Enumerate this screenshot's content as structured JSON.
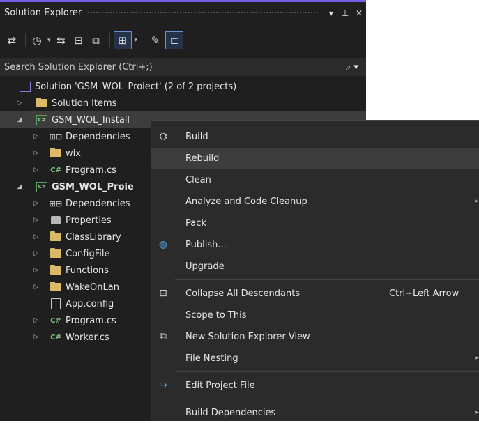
{
  "panel": {
    "title": "Solution Explorer",
    "buttons": {
      "dropdown": "▾",
      "pin": "ᚚ",
      "close": "✕"
    }
  },
  "toolbar": {
    "icons": [
      "sync-with-active-document-icon",
      "pending-changes-filter-icon",
      "switch-views-icon",
      "collapse-all-icon",
      "show-all-files-icon",
      "preview-selected-icon",
      "properties-icon",
      "filter-icon"
    ]
  },
  "search": {
    "placeholder": "Search Solution Explorer (Ctrl+;)",
    "icon": "search-icon"
  },
  "tree": {
    "solution": "Solution 'GSM_WOL_Proiect' (2 of 2 projects)",
    "items": [
      {
        "label": "Solution Items",
        "icon": "folder-icon"
      },
      {
        "label": "GSM_WOL_Install",
        "icon": "csproj-icon"
      },
      {
        "label": "Dependencies",
        "icon": "dependencies-icon"
      },
      {
        "label": "wix",
        "icon": "folder-icon"
      },
      {
        "label": "Program.cs",
        "icon": "csharp-file-icon"
      },
      {
        "label": "GSM_WOL_Proie",
        "icon": "csproj-icon"
      },
      {
        "label": "Dependencies",
        "icon": "dependencies-icon"
      },
      {
        "label": "Properties",
        "icon": "properties-folder-icon"
      },
      {
        "label": "ClassLibrary",
        "icon": "folder-icon"
      },
      {
        "label": "ConfigFile",
        "icon": "folder-icon"
      },
      {
        "label": "Functions",
        "icon": "folder-icon"
      },
      {
        "label": "WakeOnLan",
        "icon": "folder-icon"
      },
      {
        "label": "App.config",
        "icon": "config-file-icon"
      },
      {
        "label": "Program.cs",
        "icon": "csharp-file-icon"
      },
      {
        "label": "Worker.cs",
        "icon": "csharp-file-icon"
      }
    ]
  },
  "context_menu": {
    "items": [
      {
        "label": "Build",
        "icon": "build-icon"
      },
      {
        "label": "Rebuild",
        "highlighted": true
      },
      {
        "label": "Clean"
      },
      {
        "label": "Analyze and Code Cleanup",
        "submenu": true
      },
      {
        "label": "Pack"
      },
      {
        "label": "Publish...",
        "icon": "publish-globe-icon"
      },
      {
        "label": "Upgrade"
      },
      {
        "label": "Collapse All Descendants",
        "shortcut": "Ctrl+Left Arrow",
        "icon": "collapse-icon"
      },
      {
        "label": "Scope to This"
      },
      {
        "label": "New Solution Explorer View",
        "icon": "new-view-icon"
      },
      {
        "label": "File Nesting",
        "submenu": true
      },
      {
        "label": "Edit Project File",
        "icon": "edit-redo-icon"
      },
      {
        "label": "Build Dependencies",
        "submenu": true
      }
    ]
  },
  "colors": {
    "accent": "#7160e8",
    "panel_bg": "#1f1f1f",
    "menu_bg": "#2b2b2b",
    "highlight": "#3d3d3d"
  }
}
